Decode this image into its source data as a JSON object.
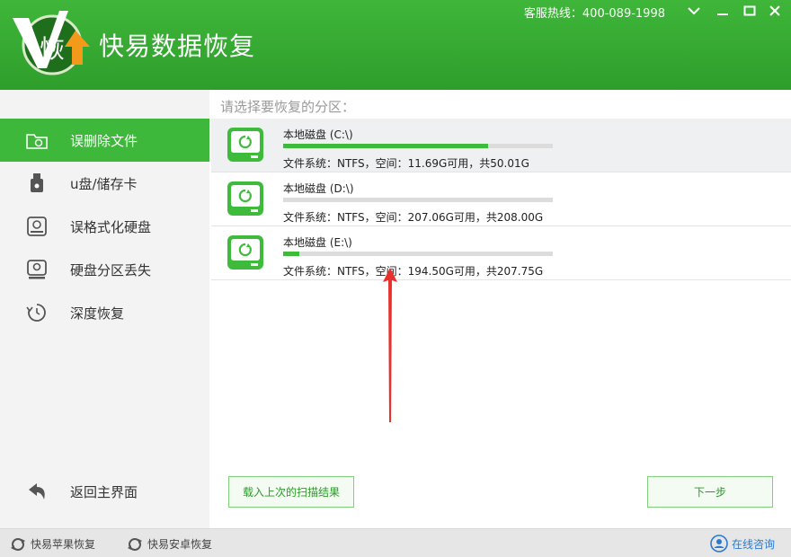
{
  "app": {
    "logo_char": "恢",
    "title": "快易数据恢复",
    "hotline": "客服热线：400-089-1998"
  },
  "sidebar": {
    "items": [
      {
        "label": "误删除文件",
        "icon": "folder-icon"
      },
      {
        "label": "u盘/储存卡",
        "icon": "usb-drive-icon"
      },
      {
        "label": "误格式化硬盘",
        "icon": "hard-disk-icon"
      },
      {
        "label": "硬盘分区丢失",
        "icon": "disk-partition-icon"
      },
      {
        "label": "深度恢复",
        "icon": "deep-recovery-icon"
      }
    ],
    "back_label": "返回主界面"
  },
  "main": {
    "prompt": "请选择要恢复的分区：",
    "drives": [
      {
        "name": "本地磁盘 (C:\\)",
        "info": "文件系统：NTFS，空间：11.69G可用，共50.01G",
        "used_fraction": 0.76
      },
      {
        "name": "本地磁盘 (D:\\)",
        "info": "文件系统：NTFS，空间：207.06G可用，共208.00G",
        "used_fraction": 0.0
      },
      {
        "name": "本地磁盘 (E:\\)",
        "info": "文件系统：NTFS，空间：194.50G可用，共207.75G",
        "used_fraction": 0.06
      }
    ],
    "load_button": "载入上次的扫描结果",
    "next_button": "下一步"
  },
  "footer": {
    "apple_link": "快易苹果恢复",
    "android_link": "快易安卓恢复",
    "consult_link": "在线咨询"
  },
  "colors": {
    "brand_green": "#3db83a",
    "arrow_red": "#e8312c",
    "link_blue": "#2a7ad1"
  }
}
